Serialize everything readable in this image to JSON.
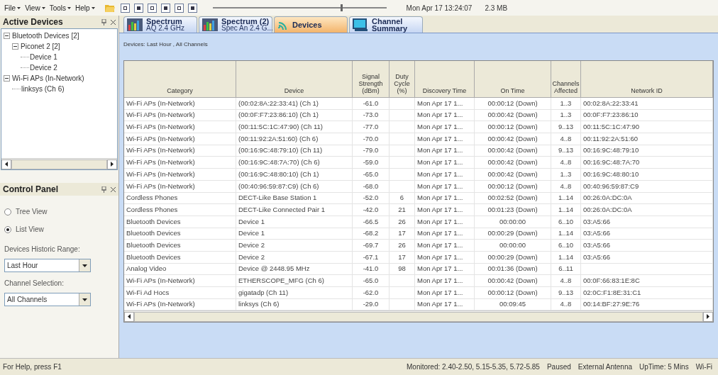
{
  "menu": [
    {
      "label": "File"
    },
    {
      "label": "View"
    },
    {
      "label": "Tools"
    },
    {
      "label": "Help"
    }
  ],
  "toolbar": {
    "slider": {
      "level": 0.74
    },
    "clock": "Mon Apr 17 13:24:07",
    "memory": "2.3 MB"
  },
  "active_devices": {
    "title": "Active Devices",
    "tree": [
      {
        "label": "Bluetooth Devices [2]",
        "expanded": true,
        "children": [
          {
            "label": "Piconet 2 [2]",
            "expanded": true,
            "children": [
              {
                "label": "Device 1"
              },
              {
                "label": "Device 2"
              }
            ]
          }
        ]
      },
      {
        "label": "Wi-Fi APs (In-Network)",
        "expanded": true,
        "children": [
          {
            "label": "linksys (Ch 6)"
          }
        ]
      }
    ]
  },
  "control_panel": {
    "title": "Control Panel",
    "views": [
      {
        "label": "Tree View",
        "selected": false
      },
      {
        "label": "List View",
        "selected": true
      }
    ],
    "fields": [
      {
        "label": "Devices Historic Range:",
        "value": "Last Hour"
      },
      {
        "label": "Channel Selection:",
        "value": "All Channels"
      }
    ]
  },
  "tabs": [
    {
      "title": "Spectrum",
      "subtitle": "AQ 2.4 GHz",
      "kind": "spectrum",
      "selected": false
    },
    {
      "title": "Spectrum (2)",
      "subtitle": "Spec An 2.4 G...",
      "kind": "spectrum",
      "selected": false
    },
    {
      "title": "Devices",
      "kind": "devices",
      "selected": true
    },
    {
      "title": "Channel",
      "subtitle": "Summary",
      "kind": "summary",
      "selected": false
    }
  ],
  "filter_caption": "Devices: Last Hour , All Channels",
  "table": {
    "columns": [
      "Category",
      "Device",
      "Signal Strength (dBm)",
      "Duty Cycle (%)",
      "Discovery Time",
      "On Time",
      "Channels Affected",
      "Network ID"
    ],
    "rows": [
      [
        "Wi-Fi APs (In-Network)",
        "(00:02:8A:22:33:41) (Ch 1)",
        "-61.0",
        "",
        "Mon Apr 17 1...",
        "00:00:12 (Down)",
        "1..3",
        "00:02:8A:22:33:41"
      ],
      [
        "Wi-Fi APs (In-Network)",
        "(00:0F:F7:23:86:10) (Ch 1)",
        "-73.0",
        "",
        "Mon Apr 17 1...",
        "00:00:42 (Down)",
        "1..3",
        "00:0F:F7:23:86:10"
      ],
      [
        "Wi-Fi APs (In-Network)",
        "(00:11:5C:1C:47:90) (Ch 11)",
        "-77.0",
        "",
        "Mon Apr 17 1...",
        "00:00:12 (Down)",
        "9..13",
        "00:11:5C:1C:47:90"
      ],
      [
        "Wi-Fi APs (In-Network)",
        "(00:11:92:2A:51:60) (Ch 6)",
        "-70.0",
        "",
        "Mon Apr 17 1...",
        "00:00:42 (Down)",
        "4..8",
        "00:11:92:2A:51:60"
      ],
      [
        "Wi-Fi APs (In-Network)",
        "(00:16:9C:48:79:10) (Ch 11)",
        "-79.0",
        "",
        "Mon Apr 17 1...",
        "00:00:42 (Down)",
        "9..13",
        "00:16:9C:48:79:10"
      ],
      [
        "Wi-Fi APs (In-Network)",
        "(00:16:9C:48:7A:70) (Ch 6)",
        "-59.0",
        "",
        "Mon Apr 17 1...",
        "00:00:42 (Down)",
        "4..8",
        "00:16:9C:48:7A:70"
      ],
      [
        "Wi-Fi APs (In-Network)",
        "(00:16:9C:48:80:10) (Ch 1)",
        "-65.0",
        "",
        "Mon Apr 17 1...",
        "00:00:42 (Down)",
        "1..3",
        "00:16:9C:48:80:10"
      ],
      [
        "Wi-Fi APs (In-Network)",
        "(00:40:96:59:87:C9) (Ch 6)",
        "-68.0",
        "",
        "Mon Apr 17 1...",
        "00:00:12 (Down)",
        "4..8",
        "00:40:96:59:87:C9"
      ],
      [
        "Cordless Phones",
        "DECT-Like Base Station 1",
        "-52.0",
        "6",
        "Mon Apr 17 1...",
        "00:02:52 (Down)",
        "1..14",
        "00:26:0A:DC:0A"
      ],
      [
        "Cordless Phones",
        "DECT-Like Connected Pair 1",
        "-42.0",
        "21",
        "Mon Apr 17 1...",
        "00:01:23 (Down)",
        "1..14",
        "00:26:0A:DC:0A"
      ],
      [
        "Bluetooth Devices",
        "Device 1",
        "-66.5",
        "26",
        "Mon Apr 17 1...",
        "00:00:00",
        "6..10",
        "03:A5:66"
      ],
      [
        "Bluetooth Devices",
        "Device 1",
        "-68.2",
        "17",
        "Mon Apr 17 1...",
        "00:00:29 (Down)",
        "1..14",
        "03:A5:66"
      ],
      [
        "Bluetooth Devices",
        "Device 2",
        "-69.7",
        "26",
        "Mon Apr 17 1...",
        "00:00:00",
        "6..10",
        "03:A5:66"
      ],
      [
        "Bluetooth Devices",
        "Device 2",
        "-67.1",
        "17",
        "Mon Apr 17 1...",
        "00:00:29 (Down)",
        "1..14",
        "03:A5:66"
      ],
      [
        "Analog Video",
        "Device @ 2448.95 MHz",
        "-41.0",
        "98",
        "Mon Apr 17 1...",
        "00:01:36 (Down)",
        "6..11",
        ""
      ],
      [
        "Wi-Fi APs (In-Network)",
        "ETHERSCOPE_MFG (Ch 6)",
        "-65.0",
        "",
        "Mon Apr 17 1...",
        "00:00:42 (Down)",
        "4..8",
        "00:0F:66:83:1E:8C"
      ],
      [
        "Wi-Fi Ad Hocs",
        "gigatadp (Ch 11)",
        "-62.0",
        "",
        "Mon Apr 17 1...",
        "00:00:12 (Down)",
        "9..13",
        "02:0C:F1:8E:31:C1"
      ],
      [
        "Wi-Fi APs (In-Network)",
        "linksys (Ch 6)",
        "-29.0",
        "",
        "Mon Apr 17 1...",
        "00:09:45",
        "4..8",
        "00:14:BF:27:9E:76"
      ]
    ]
  },
  "status_bar": {
    "help": "For Help, press F1",
    "segments": [
      "Monitored: 2.40-2.50, 5.15-5.35, 5.72-5.85",
      "Paused",
      "External Antenna",
      "UpTime: 5 Mins",
      "Wi-Fi"
    ]
  }
}
